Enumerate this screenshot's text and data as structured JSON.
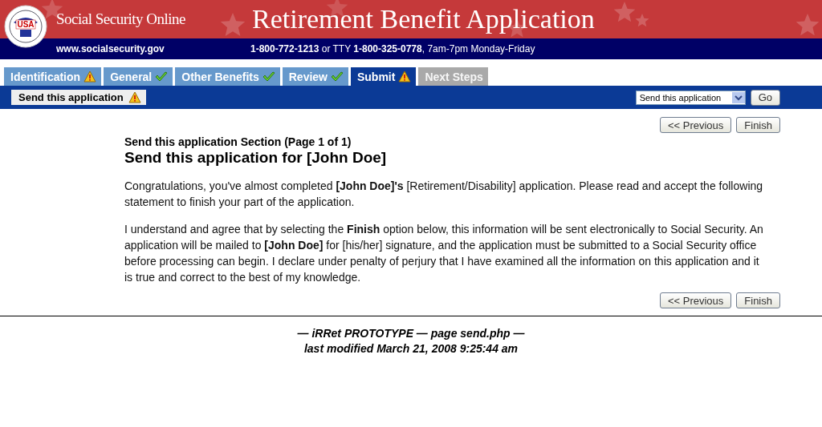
{
  "header": {
    "site_name": "Social Security Online",
    "title": "Retirement Benefit Application",
    "url": "www.socialsecurity.gov",
    "logo_text": "USA",
    "phone": "**1-800-772-1213** or TTY **1-800-325-0778**, 7am-7pm Monday-Friday"
  },
  "tabs": [
    {
      "label": "Identification",
      "kind": "warning",
      "selected": false,
      "disabled": false
    },
    {
      "label": "General",
      "kind": "complete",
      "selected": false,
      "disabled": false
    },
    {
      "label": "Other Benefits",
      "kind": "complete",
      "selected": false,
      "disabled": false
    },
    {
      "label": "Review",
      "kind": "complete",
      "selected": false,
      "disabled": false
    },
    {
      "label": "Submit",
      "kind": "warning",
      "selected": true,
      "disabled": false
    },
    {
      "label": "Next Steps",
      "kind": "pending",
      "selected": false,
      "disabled": true
    }
  ],
  "subnav": {
    "section": {
      "label": "Send this application",
      "kind": "warning"
    },
    "jump_select": {
      "value": "Send this application"
    },
    "go_button": "Go"
  },
  "top_buttons": [
    "<< Previous",
    "Finish"
  ],
  "section_heading": "Send this application Section (Page 1 of 1)",
  "page_title": "Send this application for [John Doe]",
  "paragraphs": [
    "Congratulations, you've almost completed **[John Doe]'s** [Retirement/Disability] application. Please read and accept the following statement to finish your part of the application.",
    "I understand and agree that by selecting the **Finish** option below, this information will be sent electronically to Social Security. An application will be mailed to **[John Doe]** for [his/her] signature, and the application must be submitted to a Social Security office before processing can begin. I declare under penalty of perjury that I have examined all the information on this application and it is true and correct to the best of my knowledge."
  ],
  "bottom_buttons": [
    "<< Previous",
    "Finish"
  ],
  "footer": [
    "— iRRet PROTOTYPE — page send.php —",
    "last modified March 21, 2008 9:25:44 am"
  ]
}
